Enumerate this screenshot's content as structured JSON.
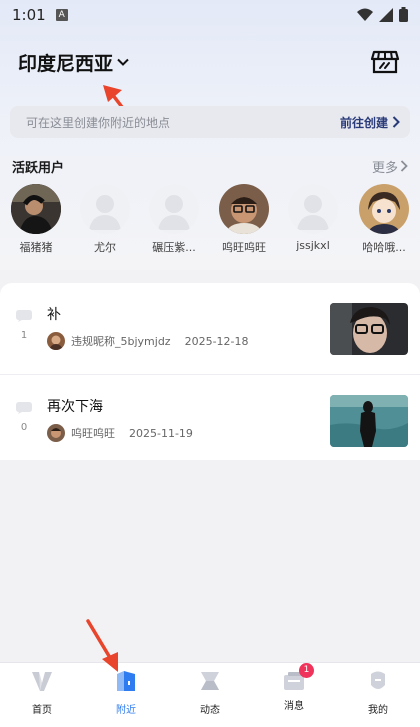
{
  "status_bar": {
    "time": "1:01",
    "sim_label": "A"
  },
  "header": {
    "region": "印度尼西亚"
  },
  "create_bar": {
    "hint": "可在这里创建你附近的地点",
    "link": "前往创建"
  },
  "active_users": {
    "title": "活跃用户",
    "more": "更多",
    "users": [
      {
        "name": "福猪猪",
        "avatar": "photo-dark"
      },
      {
        "name": "尤尔",
        "avatar": "placeholder"
      },
      {
        "name": "碾压紫...",
        "avatar": "placeholder"
      },
      {
        "name": "呜旺呜旺",
        "avatar": "photo-glasses"
      },
      {
        "name": "jssjkxl",
        "avatar": "placeholder"
      },
      {
        "name": "哈哈哦...",
        "avatar": "anime"
      }
    ]
  },
  "posts": [
    {
      "title": "补",
      "comments": "1",
      "author": "违规昵称_5bjymjdz",
      "date": "2025-12-18",
      "thumb": "selfie-glasses"
    },
    {
      "title": "再次下海",
      "comments": "0",
      "author": "呜旺呜旺",
      "date": "2025-11-19",
      "thumb": "diver-sea"
    }
  ],
  "tabbar": {
    "tabs": [
      {
        "label": "首页",
        "icon": "v-logo-icon",
        "active": false
      },
      {
        "label": "附近",
        "icon": "nearby-icon",
        "active": true
      },
      {
        "label": "动态",
        "icon": "feed-icon",
        "active": false
      },
      {
        "label": "消息",
        "icon": "message-icon",
        "active": false,
        "badge": "1"
      },
      {
        "label": "我的",
        "icon": "profile-icon",
        "active": false
      }
    ]
  },
  "colors": {
    "accent": "#2f7cf0",
    "badge": "#f0335a",
    "annotation_arrow": "#e8452c"
  }
}
